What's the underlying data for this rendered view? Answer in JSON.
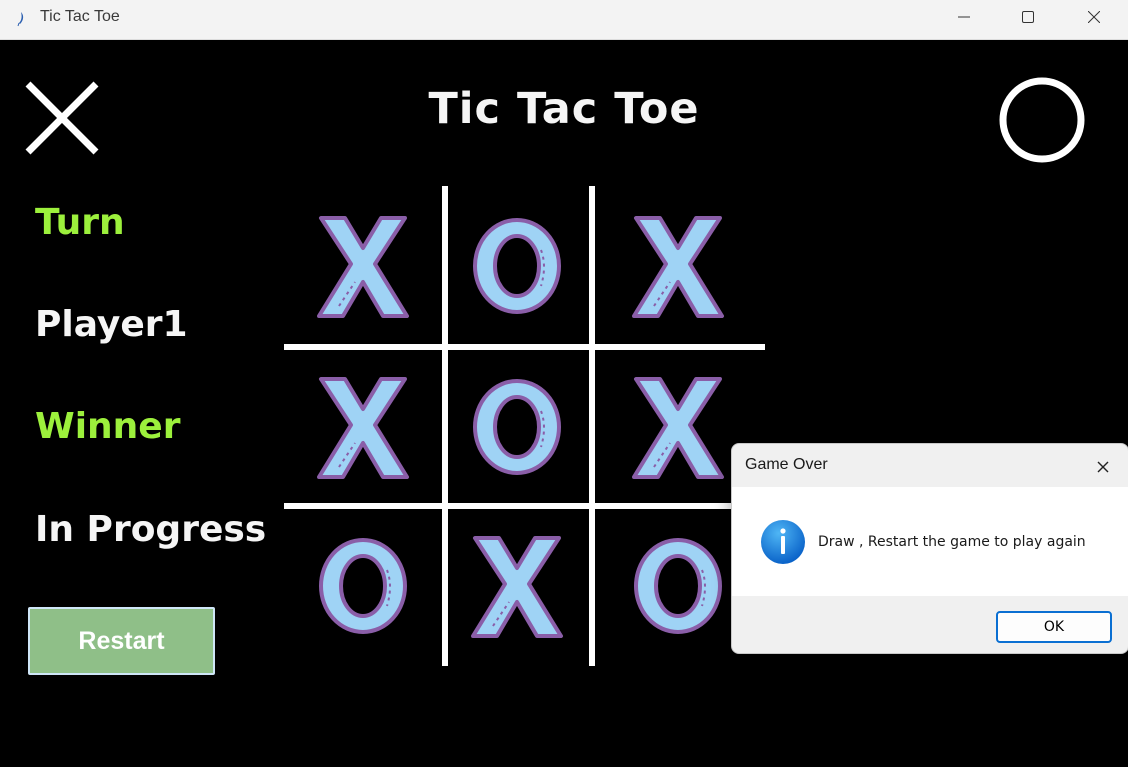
{
  "window": {
    "title": "Tic Tac Toe",
    "icon": "feather-app-icon",
    "controls": [
      "minimize-icon",
      "maximize-icon",
      "close-icon"
    ]
  },
  "game": {
    "title": "Tic Tac Toe",
    "turn_label": "Turn",
    "current_player": "Player1",
    "winner_label": "Winner",
    "status": "In Progress",
    "restart_label": "Restart",
    "board": [
      [
        "X",
        "O",
        "X"
      ],
      [
        "X",
        "O",
        "X"
      ],
      [
        "O",
        "X",
        "O"
      ]
    ],
    "colors": {
      "label_green": "#9cf03c",
      "text_white": "#f5f5f5",
      "restart_bg": "#8fbf88",
      "mark_fill": "#9fd3f5",
      "mark_outline": "#8a5ea8"
    }
  },
  "dialog": {
    "title": "Game Over",
    "message": "Draw , Restart the game to play again",
    "ok_label": "OK",
    "icon": "info-icon"
  }
}
